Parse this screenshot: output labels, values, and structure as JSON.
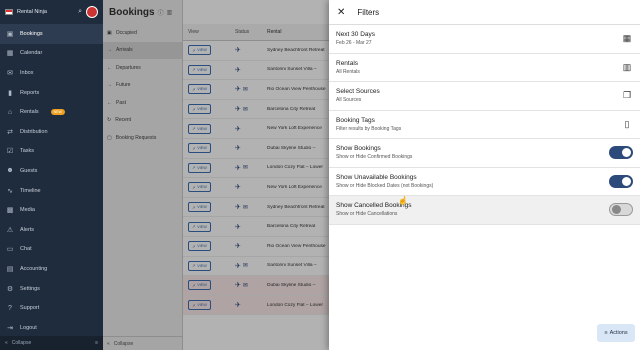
{
  "sidebar": {
    "brand": "Rental Ninja",
    "items": [
      {
        "label": "Bookings",
        "icon": "bookings-icon",
        "glyph": "▣"
      },
      {
        "label": "Calendar",
        "icon": "calendar-icon",
        "glyph": "▦"
      },
      {
        "label": "Inbox",
        "icon": "inbox-icon",
        "glyph": "✉"
      },
      {
        "label": "Reports",
        "icon": "reports-icon",
        "glyph": "▮"
      },
      {
        "label": "Rentals",
        "icon": "rentals-icon",
        "glyph": "⌂",
        "badge": "NEW"
      },
      {
        "label": "Distribution",
        "icon": "distribution-icon",
        "glyph": "⇄"
      },
      {
        "label": "Tasks",
        "icon": "tasks-icon",
        "glyph": "☑"
      },
      {
        "label": "Guests",
        "icon": "guests-icon",
        "glyph": "☻"
      },
      {
        "label": "Timeline",
        "icon": "timeline-icon",
        "glyph": "∿"
      },
      {
        "label": "Media",
        "icon": "media-icon",
        "glyph": "▩"
      },
      {
        "label": "Alerts",
        "icon": "alerts-icon",
        "glyph": "⚠"
      },
      {
        "label": "Chat",
        "icon": "chat-icon",
        "glyph": "▭"
      },
      {
        "label": "Accounting",
        "icon": "accounting-icon",
        "glyph": "▤"
      },
      {
        "label": "Settings",
        "icon": "settings-icon",
        "glyph": "⚙"
      },
      {
        "label": "Support",
        "icon": "support-icon",
        "glyph": "?"
      },
      {
        "label": "Logout",
        "icon": "logout-icon",
        "glyph": "⇥"
      }
    ],
    "collapse": "Collapse"
  },
  "subnav": {
    "title": "Bookings",
    "items": [
      {
        "label": "Occupied",
        "glyph": "▣"
      },
      {
        "label": "Arrivals",
        "glyph": "→"
      },
      {
        "label": "Departures",
        "glyph": "←"
      },
      {
        "label": "Future",
        "glyph": "→"
      },
      {
        "label": "Past",
        "glyph": "←"
      },
      {
        "label": "Recent",
        "glyph": "↻"
      },
      {
        "label": "Booking Requests",
        "glyph": "▢"
      }
    ],
    "collapse": "Collapse"
  },
  "table": {
    "headers": [
      "View",
      "Status",
      "Rental"
    ],
    "view_label": "VIEW",
    "rows": [
      {
        "rental": "Sydney Beachfront Retreat",
        "mail": false,
        "pink": false
      },
      {
        "rental": "Santorini Sunset Villa –",
        "mail": false,
        "pink": false
      },
      {
        "rental": "Rio Ocean View Penthouse",
        "mail": true,
        "pink": false
      },
      {
        "rental": "Barcelona City Retreat",
        "mail": true,
        "pink": false
      },
      {
        "rental": "New York Loft Experience",
        "mail": false,
        "pink": false
      },
      {
        "rental": "Dubai Skyline Studio –",
        "mail": false,
        "pink": false
      },
      {
        "rental": "London Cozy Flat – Lower",
        "mail": true,
        "pink": false
      },
      {
        "rental": "New York Loft Experience",
        "mail": false,
        "pink": false
      },
      {
        "rental": "Sydney Beachfront Retreat",
        "mail": true,
        "pink": false
      },
      {
        "rental": "Barcelona City Retreat",
        "mail": false,
        "pink": false
      },
      {
        "rental": "Rio Ocean View Penthouse",
        "mail": false,
        "pink": false
      },
      {
        "rental": "Santorini Sunset Villa –",
        "mail": true,
        "pink": false
      },
      {
        "rental": "Dubai Skyline Studio –",
        "mail": true,
        "pink": true
      },
      {
        "rental": "London Cozy Flat – Lower",
        "mail": false,
        "pink": true
      }
    ]
  },
  "filters": {
    "title": "Filters",
    "rows": [
      {
        "title": "Next 30 Days",
        "subtitle": "Feb 26 - Mar 27",
        "type": "icon",
        "icon": "calendar-icon",
        "glyph": "▦"
      },
      {
        "title": "Rentals",
        "subtitle": "All Rentals",
        "type": "icon",
        "icon": "building-icon",
        "glyph": "▥"
      },
      {
        "title": "Select Sources",
        "subtitle": "All Sources",
        "type": "icon",
        "icon": "sources-icon",
        "glyph": "❐"
      },
      {
        "title": "Booking Tags",
        "subtitle": "Filter results by Booking Tags",
        "type": "icon",
        "icon": "bookmark-icon",
        "glyph": "▯"
      },
      {
        "title": "Show Bookings",
        "subtitle": "Show or Hide Confirmed Bookings",
        "type": "toggle",
        "on": true
      },
      {
        "title": "Show Unavailable Bookings",
        "subtitle": "Show or Hide Blocked Dates (not Bookings)",
        "type": "toggle",
        "on": true
      },
      {
        "title": "Show Cancelled Bookings",
        "subtitle": "Show or Hide Cancellations",
        "type": "toggle",
        "on": false
      }
    ],
    "actions_label": "Actions"
  }
}
